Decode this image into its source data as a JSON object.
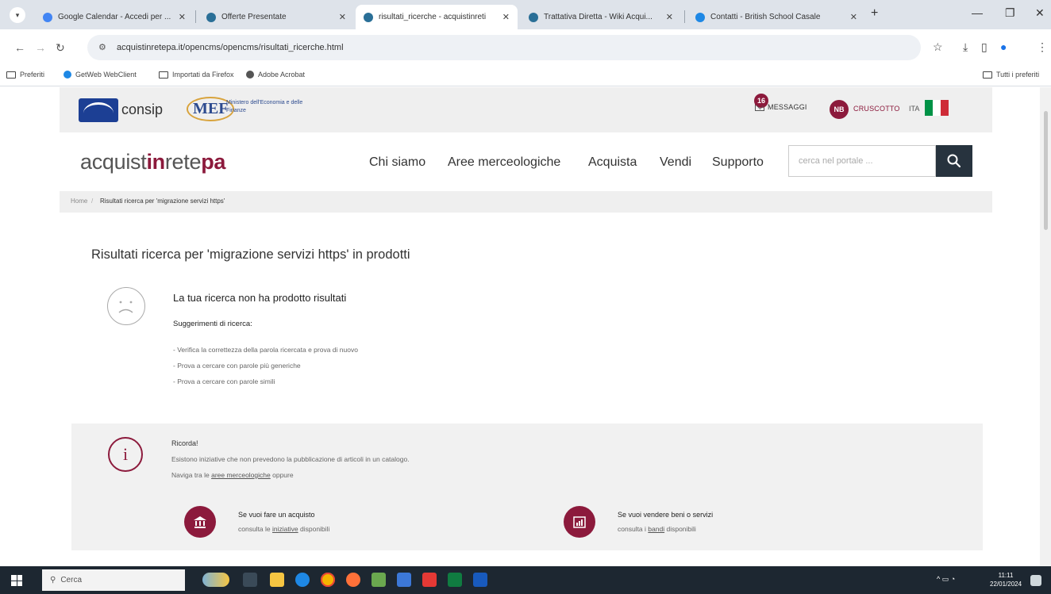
{
  "browser": {
    "tabs": [
      {
        "title": "Google Calendar - Accedi per ...",
        "favicon_color": "#4285f4",
        "active": false
      },
      {
        "title": "Offerte Presentate",
        "favicon_color": "#2a6f97",
        "active": false
      },
      {
        "title": "risultati_ricerche - acquistinreti",
        "favicon_color": "#2a6f97",
        "active": true
      },
      {
        "title": "Trattativa Diretta - Wiki Acqui...",
        "favicon_color": "#2a6f97",
        "active": false
      },
      {
        "title": "Contatti - British School Casale",
        "favicon_color": "#1e88e5",
        "active": false
      }
    ],
    "new_tab": "+",
    "url": "acquistinretepa.it/opencms/opencms/risultati_ricerche.html",
    "bookmarks": [
      {
        "label": "Preferiti",
        "type": "folder"
      },
      {
        "label": "GetWeb WebClient",
        "type": "site",
        "color": "#1e88e5"
      },
      {
        "label": "Importati da Firefox",
        "type": "folder"
      },
      {
        "label": "Adobe Acrobat",
        "type": "site",
        "color": "#555555"
      }
    ],
    "bookmarks_all": "Tutti i preferiti"
  },
  "header": {
    "consip": "consip",
    "mef": "MEF",
    "mef_sub": "Ministero dell'Economia e delle Finanze",
    "messages_count": "16",
    "messages_label": "MESSAGGI",
    "user_initials": "NB",
    "dashboard_label": "CRUSCOTTO",
    "language": "ITA",
    "flag_colors": [
      "#009246",
      "#ffffff",
      "#ce2b37"
    ]
  },
  "brand": {
    "part1": "acquist",
    "part2": "in",
    "part3": "rete",
    "part4": "pa"
  },
  "nav": [
    "Chi siamo",
    "Aree merceologiche",
    "Acquista",
    "Vendi",
    "Supporto"
  ],
  "search": {
    "placeholder": "cerca nel portale ..."
  },
  "breadcrumb": {
    "home": "Home",
    "separator": "/",
    "current": "Risultati ricerca per 'migrazione servizi https'"
  },
  "results": {
    "title": "Risultati ricerca per 'migrazione servizi https' in prodotti",
    "no_results": "La tua ricerca non ha prodotto risultati",
    "suggestions_title": "Suggerimenti di ricerca:",
    "suggestions": [
      "- Verifica la correttezza della parola ricercata e prova di nuovo",
      "- Prova a cercare con parole più generiche",
      "- Prova a cercare con parole simili"
    ]
  },
  "info": {
    "title": "Ricorda!",
    "line1": "Esistono iniziative che non prevedono la pubblicazione di articoli in un catalogo.",
    "line2_pre": "Naviga tra le",
    "line2_link": "aree merceologiche",
    "line2_post": "oppure",
    "buy_title": "Se vuoi fare un acquisto",
    "buy_pre": "consulta le",
    "buy_link": "iniziative",
    "buy_post": "disponibili",
    "sell_title": "Se vuoi vendere beni o servizi",
    "sell_pre": "consulta i",
    "sell_link": "bandi",
    "sell_post": "disponibili"
  },
  "taskbar": {
    "search": "Cerca",
    "time": "11:11",
    "date": "22/01/2024"
  },
  "colors": {
    "accent": "#8c1a3c",
    "dark": "#27333e"
  }
}
